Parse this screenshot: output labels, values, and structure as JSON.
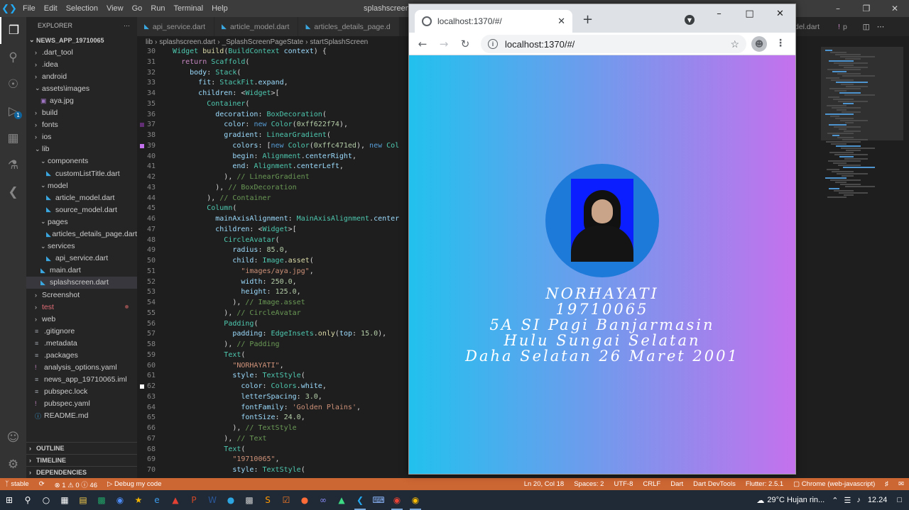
{
  "vscode": {
    "menu": [
      "File",
      "Edit",
      "Selection",
      "View",
      "Go",
      "Run",
      "Terminal",
      "Help"
    ],
    "title": "splashscreen.d",
    "tabs": [
      {
        "label": "api_service.dart",
        "active": false
      },
      {
        "label": "article_model.dart",
        "active": false
      },
      {
        "label": "articles_details_page.d",
        "active": false
      }
    ],
    "right_tab": "del.dart",
    "right_tab2": "p",
    "breadcrumb": [
      "lib",
      "splashscreen.dart",
      "_SplashScreenPageState",
      "startSplashScreen"
    ]
  },
  "explorer": {
    "header": "EXPLORER",
    "project": "NEWS_APP_19710065",
    "tree": [
      {
        "label": ".dart_tool",
        "depth": 1,
        "type": "folder"
      },
      {
        "label": ".idea",
        "depth": 1,
        "type": "folder"
      },
      {
        "label": "android",
        "depth": 1,
        "type": "folder"
      },
      {
        "label": "assets\\images",
        "depth": 1,
        "type": "folder-open"
      },
      {
        "label": "aya.jpg",
        "depth": 2,
        "type": "image"
      },
      {
        "label": "build",
        "depth": 1,
        "type": "folder"
      },
      {
        "label": "fonts",
        "depth": 1,
        "type": "folder"
      },
      {
        "label": "ios",
        "depth": 1,
        "type": "folder"
      },
      {
        "label": "lib",
        "depth": 1,
        "type": "folder-open"
      },
      {
        "label": "components",
        "depth": 2,
        "type": "folder-open"
      },
      {
        "label": "customListTitle.dart",
        "depth": 3,
        "type": "dart"
      },
      {
        "label": "model",
        "depth": 2,
        "type": "folder-open"
      },
      {
        "label": "article_model.dart",
        "depth": 3,
        "type": "dart"
      },
      {
        "label": "source_model.dart",
        "depth": 3,
        "type": "dart"
      },
      {
        "label": "pages",
        "depth": 2,
        "type": "folder-open"
      },
      {
        "label": "articles_details_page.dart",
        "depth": 3,
        "type": "dart"
      },
      {
        "label": "services",
        "depth": 2,
        "type": "folder-open"
      },
      {
        "label": "api_service.dart",
        "depth": 3,
        "type": "dart"
      },
      {
        "label": "main.dart",
        "depth": 2,
        "type": "dart"
      },
      {
        "label": "splashscreen.dart",
        "depth": 2,
        "type": "dart",
        "selected": true
      },
      {
        "label": "Screenshot",
        "depth": 1,
        "type": "folder"
      },
      {
        "label": "test",
        "depth": 1,
        "type": "folder",
        "modified": true
      },
      {
        "label": "web",
        "depth": 1,
        "type": "folder"
      },
      {
        "label": ".gitignore",
        "depth": 1,
        "type": "file"
      },
      {
        "label": ".metadata",
        "depth": 1,
        "type": "file"
      },
      {
        "label": ".packages",
        "depth": 1,
        "type": "file"
      },
      {
        "label": "analysis_options.yaml",
        "depth": 1,
        "type": "yaml"
      },
      {
        "label": "news_app_19710065.iml",
        "depth": 1,
        "type": "file"
      },
      {
        "label": "pubspec.lock",
        "depth": 1,
        "type": "file"
      },
      {
        "label": "pubspec.yaml",
        "depth": 1,
        "type": "yaml"
      },
      {
        "label": "README.md",
        "depth": 1,
        "type": "info"
      }
    ],
    "sections": [
      "OUTLINE",
      "TIMELINE",
      "DEPENDENCIES"
    ]
  },
  "code": {
    "lines": [
      {
        "n": 30,
        "html": "  <span class=\"ty\">Widget</span> <span class=\"fn\">build</span><span class=\"pl\">(</span><span class=\"ty\">BuildContext</span> <span class=\"pr\">context</span><span class=\"pl\">) {</span>"
      },
      {
        "n": 31,
        "html": "    <span class=\"ctl\">return</span> <span class=\"ty\">Scaffold</span><span class=\"pl\">(</span>"
      },
      {
        "n": 32,
        "html": "      <span class=\"pr\">body</span><span class=\"pl\">:</span> <span class=\"ty\">Stack</span><span class=\"pl\">(</span>"
      },
      {
        "n": 33,
        "html": "        <span class=\"pr\">fit</span><span class=\"pl\">:</span> <span class=\"ty\">StackFit</span><span class=\"pl\">.</span><span class=\"pr\">expand</span><span class=\"pl\">,</span>"
      },
      {
        "n": 34,
        "html": "        <span class=\"pr\">children</span><span class=\"pl\">: &lt;</span><span class=\"ty\">Widget</span><span class=\"pl\">&gt;[</span>"
      },
      {
        "n": 35,
        "html": "          <span class=\"ty\">Container</span><span class=\"pl\">(</span>"
      },
      {
        "n": 36,
        "html": "            <span class=\"pr\">decoration</span><span class=\"pl\">:</span> <span class=\"ty\">BoxDecoration</span><span class=\"pl\">(</span>"
      },
      {
        "n": 37,
        "html": "              <span class=\"pr\">color</span><span class=\"pl\">:</span> <span class=\"kw\">new</span> <span class=\"ty\">Color</span><span class=\"pl\">(</span><span class=\"nu\">0xff622f74</span><span class=\"pl\">),</span>",
        "mark": "#622f74"
      },
      {
        "n": 38,
        "html": "              <span class=\"pr\">gradient</span><span class=\"pl\">:</span> <span class=\"ty\">LinearGradient</span><span class=\"pl\">(</span>"
      },
      {
        "n": 39,
        "html": "                <span class=\"pr\">colors</span><span class=\"pl\">: [</span><span class=\"kw\">new</span> <span class=\"ty\">Color</span><span class=\"pl\">(</span><span class=\"nu\">0xffc471ed</span><span class=\"pl\">),</span> <span class=\"kw\">new</span> <span class=\"ty\">Col</span>",
        "mark": "#c471ed"
      },
      {
        "n": 40,
        "html": "                <span class=\"pr\">begin</span><span class=\"pl\">:</span> <span class=\"ty\">Alignment</span><span class=\"pl\">.</span><span class=\"pr\">centerRight</span><span class=\"pl\">,</span>"
      },
      {
        "n": 41,
        "html": "                <span class=\"pr\">end</span><span class=\"pl\">:</span> <span class=\"ty\">Alignment</span><span class=\"pl\">.</span><span class=\"pr\">centerLeft</span><span class=\"pl\">,</span>"
      },
      {
        "n": 42,
        "html": "              <span class=\"pl\">),</span> <span class=\"cm\">// LinearGradient</span>"
      },
      {
        "n": 43,
        "html": "            <span class=\"pl\">),</span> <span class=\"cm\">// BoxDecoration</span>"
      },
      {
        "n": 44,
        "html": "          <span class=\"pl\">),</span> <span class=\"cm\">// Container</span>"
      },
      {
        "n": 45,
        "html": "          <span class=\"ty\">Column</span><span class=\"pl\">(</span>"
      },
      {
        "n": 46,
        "html": "            <span class=\"pr\">mainAxisAlignment</span><span class=\"pl\">:</span> <span class=\"ty\">MainAxisAlignment</span><span class=\"pl\">.</span><span class=\"pr\">center</span>"
      },
      {
        "n": 47,
        "html": "            <span class=\"pr\">children</span><span class=\"pl\">: &lt;</span><span class=\"ty\">Widget</span><span class=\"pl\">&gt;[</span>"
      },
      {
        "n": 48,
        "html": "              <span class=\"ty\">CircleAvatar</span><span class=\"pl\">(</span>"
      },
      {
        "n": 49,
        "html": "                <span class=\"pr\">radius</span><span class=\"pl\">:</span> <span class=\"nu\">85.0</span><span class=\"pl\">,</span>"
      },
      {
        "n": 50,
        "html": "                <span class=\"pr\">child</span><span class=\"pl\">:</span> <span class=\"ty\">Image</span><span class=\"pl\">.</span><span class=\"fn\">asset</span><span class=\"pl\">(</span>"
      },
      {
        "n": 51,
        "html": "                  <span class=\"st\">\"images/aya.jpg\"</span><span class=\"pl\">,</span>"
      },
      {
        "n": 52,
        "html": "                  <span class=\"pr\">width</span><span class=\"pl\">:</span> <span class=\"nu\">250.0</span><span class=\"pl\">,</span>"
      },
      {
        "n": 53,
        "html": "                  <span class=\"pr\">height</span><span class=\"pl\">:</span> <span class=\"nu\">125.0</span><span class=\"pl\">,</span>"
      },
      {
        "n": 54,
        "html": "                <span class=\"pl\">),</span> <span class=\"cm\">// Image.asset</span>"
      },
      {
        "n": 55,
        "html": "              <span class=\"pl\">),</span> <span class=\"cm\">// CircleAvatar</span>"
      },
      {
        "n": 56,
        "html": "              <span class=\"ty\">Padding</span><span class=\"pl\">(</span>"
      },
      {
        "n": 57,
        "html": "                <span class=\"pr\">padding</span><span class=\"pl\">:</span> <span class=\"ty\">EdgeInsets</span><span class=\"pl\">.</span><span class=\"fn\">only</span><span class=\"pl\">(</span><span class=\"pr\">top</span><span class=\"pl\">:</span> <span class=\"nu\">15.0</span><span class=\"pl\">),</span>"
      },
      {
        "n": 58,
        "html": "              <span class=\"pl\">),</span> <span class=\"cm\">// Padding</span>"
      },
      {
        "n": 59,
        "html": "              <span class=\"ty\">Text</span><span class=\"pl\">(</span>"
      },
      {
        "n": 60,
        "html": "                <span class=\"st\">\"NORHAYATI\"</span><span class=\"pl\">,</span>"
      },
      {
        "n": 61,
        "html": "                <span class=\"pr\">style</span><span class=\"pl\">:</span> <span class=\"ty\">TextStyle</span><span class=\"pl\">(</span>"
      },
      {
        "n": 62,
        "html": "                  <span class=\"pr\">color</span><span class=\"pl\">:</span> <span class=\"ty\">Colors</span><span class=\"pl\">.</span><span class=\"pr\">white</span><span class=\"pl\">,</span>",
        "mark": "#ffffff"
      },
      {
        "n": 63,
        "html": "                  <span class=\"pr\">letterSpacing</span><span class=\"pl\">:</span> <span class=\"nu\">3.0</span><span class=\"pl\">,</span>"
      },
      {
        "n": 64,
        "html": "                  <span class=\"pr\">fontFamily</span><span class=\"pl\">:</span> <span class=\"st\">'Golden Plains'</span><span class=\"pl\">,</span>"
      },
      {
        "n": 65,
        "html": "                  <span class=\"pr\">fontSize</span><span class=\"pl\">:</span> <span class=\"nu\">24.0</span><span class=\"pl\">,</span>"
      },
      {
        "n": 66,
        "html": "                <span class=\"pl\">),</span> <span class=\"cm\">// TextStyle</span>"
      },
      {
        "n": 67,
        "html": "              <span class=\"pl\">),</span> <span class=\"cm\">// Text</span>"
      },
      {
        "n": 68,
        "html": "              <span class=\"ty\">Text</span><span class=\"pl\">(</span>"
      },
      {
        "n": 69,
        "html": "                <span class=\"st\">\"19710065\"</span><span class=\"pl\">,</span>"
      },
      {
        "n": 70,
        "html": "                <span class=\"pr\">style</span><span class=\"pl\">:</span> <span class=\"ty\">TextStyle</span><span class=\"pl\">(</span>"
      }
    ]
  },
  "statusbar": {
    "branch": "stable",
    "problems": "⊗ 1 ⚠ 0 ⓘ 46",
    "debug": "Debug my code",
    "position": "Ln 20, Col 18",
    "spaces": "Spaces: 2",
    "encoding": "UTF-8",
    "eol": "CRLF",
    "language": "Dart",
    "devtools": "Dart DevTools",
    "flutter": "Flutter: 2.5.1",
    "device": "Chrome (web-javascript)"
  },
  "chrome": {
    "tab_title": "localhost:1370/#/",
    "url": "localhost:1370/#/"
  },
  "app": {
    "lines": [
      "NORHAYATI",
      "19710065",
      "5A SI Pagi Banjarmasin",
      "Hulu Sungai Selatan",
      "Daha Selatan 26 Maret 2001"
    ],
    "gradient_start": "#22c1ed",
    "gradient_end": "#c471ed",
    "avatar_color": "#1e7ad8"
  },
  "taskbar": {
    "weather": "29°C  Hujan rin...",
    "time": "12.24"
  }
}
